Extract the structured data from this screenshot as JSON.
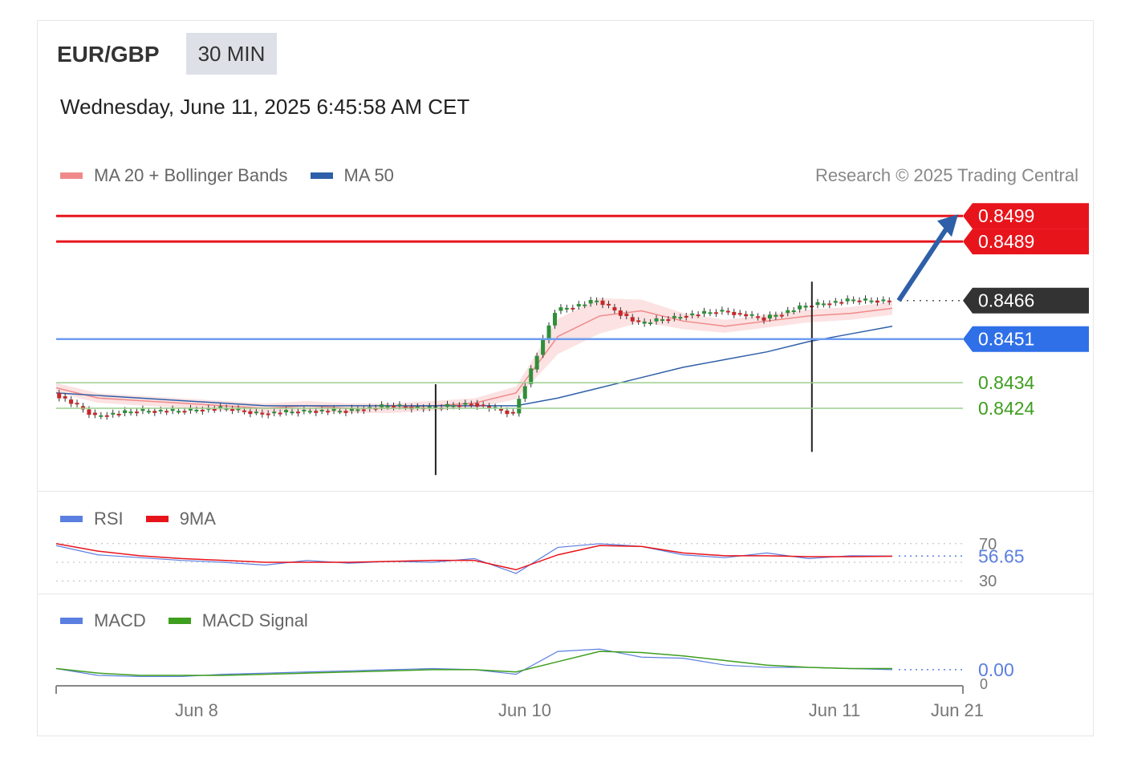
{
  "header": {
    "symbol": "EUR/GBP",
    "timeframe": "30 MIN",
    "timestamp": "Wednesday, June 11, 2025 6:45:58 AM CET",
    "credit": "Research © 2025 Trading Central"
  },
  "legends": {
    "price": [
      {
        "label": "MA 20 + Bollinger Bands",
        "color": "#f08a8a"
      },
      {
        "label": "MA 50",
        "color": "#2e5fa8"
      }
    ],
    "rsi": [
      {
        "label": "RSI",
        "color": "#5b7fe0"
      },
      {
        "label": "9MA",
        "color": "#e8141b"
      }
    ],
    "macd": [
      {
        "label": "MACD",
        "color": "#5b7fe0"
      },
      {
        "label": "MACD Signal",
        "color": "#3e9e1e"
      }
    ]
  },
  "chart_data": [
    {
      "type": "candlestick",
      "panel": "price",
      "ylim": [
        0.8394,
        0.8505
      ],
      "x_tick_labels": [
        "Jun 8",
        "Jun 10",
        "Jun 11",
        "Jun 21"
      ],
      "levels": [
        {
          "value": 0.8499,
          "label": "0.8499",
          "style": "resistance",
          "color": "#e8141b"
        },
        {
          "value": 0.8489,
          "label": "0.8489",
          "style": "resistance",
          "color": "#e8141b"
        },
        {
          "value": 0.8466,
          "label": "0.8466",
          "style": "last-price",
          "color": "#333333"
        },
        {
          "value": 0.8451,
          "label": "0.8451",
          "style": "pivot",
          "color": "#2f6fe8"
        },
        {
          "value": 0.8434,
          "label": "0.8434",
          "style": "support",
          "color": "#3e9e1e"
        },
        {
          "value": 0.8424,
          "label": "0.8424",
          "style": "support",
          "color": "#3e9e1e"
        }
      ],
      "series": [
        {
          "name": "MA 20 + Bollinger Bands",
          "values": [
            0.8432,
            0.8428,
            0.8427,
            0.8426,
            0.8425,
            0.8424,
            0.8425,
            0.8424,
            0.8424,
            0.8425,
            0.8426,
            0.843,
            0.8452,
            0.846,
            0.8462,
            0.8458,
            0.8456,
            0.8458,
            0.846,
            0.8461,
            0.8463
          ]
        },
        {
          "name": "MA 50",
          "values": [
            0.843,
            0.8429,
            0.8428,
            0.8427,
            0.8426,
            0.8425,
            0.8425,
            0.8425,
            0.8425,
            0.8425,
            0.8425,
            0.8425,
            0.8428,
            0.8432,
            0.8436,
            0.844,
            0.8443,
            0.8446,
            0.845,
            0.8453,
            0.8456
          ]
        },
        {
          "name": "Price",
          "values": [
            0.843,
            0.8421,
            0.8423,
            0.8423,
            0.8424,
            0.8422,
            0.8423,
            0.8423,
            0.8425,
            0.8424,
            0.8426,
            0.8422,
            0.8462,
            0.8466,
            0.8457,
            0.846,
            0.8462,
            0.8459,
            0.8464,
            0.8466,
            0.8466
          ]
        }
      ],
      "spikes": [
        {
          "x_index": 9,
          "low": 0.8398
        },
        {
          "x_index": 18,
          "low": 0.8407
        }
      ],
      "forecast_arrow": {
        "from": 0.8466,
        "to": 0.8499
      }
    },
    {
      "type": "line",
      "panel": "RSI",
      "ylim": [
        25,
        75
      ],
      "y_tick_labels": [
        "70",
        "30"
      ],
      "last_value": 56.65,
      "last_label": "56.65",
      "series": [
        {
          "name": "RSI",
          "values": [
            68,
            58,
            55,
            52,
            50,
            47,
            52,
            49,
            51,
            50,
            54,
            38,
            66,
            70,
            67,
            58,
            55,
            60,
            54,
            57,
            56.65
          ]
        },
        {
          "name": "9MA",
          "values": [
            70,
            62,
            57,
            54,
            52,
            50,
            50,
            50,
            51,
            52,
            52,
            42,
            58,
            68,
            67,
            60,
            57,
            57,
            56,
            56,
            56.5
          ]
        }
      ]
    },
    {
      "type": "line",
      "panel": "MACD",
      "ylim": [
        -0.0012,
        0.0028
      ],
      "last_value": 0.0,
      "last_label": "0.00",
      "y_tick_labels": [
        "0"
      ],
      "series": [
        {
          "name": "MACD",
          "values": [
            0.0001,
            -0.0005,
            -0.0006,
            -0.0006,
            -0.0004,
            -0.0003,
            -0.0002,
            -0.0001,
            0.0,
            0.0001,
            0.0,
            -0.0004,
            0.0016,
            0.0018,
            0.0011,
            0.001,
            0.0004,
            0.0002,
            0.0002,
            0.0001,
            0.0
          ]
        },
        {
          "name": "MACD Signal",
          "values": [
            0.0001,
            -0.0003,
            -0.0005,
            -0.0005,
            -0.0005,
            -0.0004,
            -0.0003,
            -0.0002,
            -0.0001,
            0.0,
            0.0,
            -0.0002,
            0.0007,
            0.0016,
            0.0015,
            0.0012,
            0.0008,
            0.0004,
            0.0002,
            0.0001,
            0.0001
          ]
        }
      ]
    }
  ]
}
